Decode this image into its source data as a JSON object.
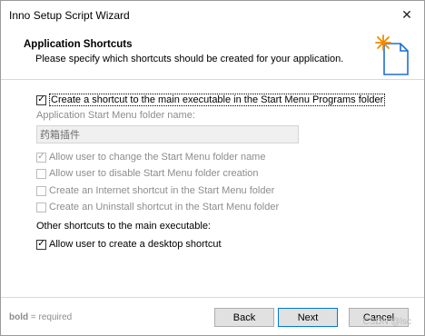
{
  "window": {
    "title": "Inno Setup Script Wizard"
  },
  "header": {
    "heading": "Application Shortcuts",
    "subheading": "Please specify which shortcuts should be created for your application."
  },
  "options": {
    "start_menu_shortcut": {
      "label": "Create a shortcut to the main executable in the Start Menu Programs folder",
      "checked": true,
      "enabled": true
    },
    "folder_name_label": "Application Start Menu folder name:",
    "folder_name_value": "药箱插件",
    "allow_change_folder": {
      "label": "Allow user to change the Start Menu folder name",
      "checked": true,
      "enabled": false
    },
    "allow_disable_folder": {
      "label": "Allow user to disable Start Menu folder creation",
      "checked": false,
      "enabled": false
    },
    "internet_shortcut": {
      "label": "Create an Internet shortcut in the Start Menu folder",
      "checked": false,
      "enabled": false
    },
    "uninstall_shortcut": {
      "label": "Create an Uninstall shortcut in the Start Menu folder",
      "checked": false,
      "enabled": false
    },
    "other_shortcuts_label": "Other shortcuts to the main executable:",
    "desktop_shortcut": {
      "label": "Allow user to create a desktop shortcut",
      "checked": true,
      "enabled": true
    }
  },
  "footer": {
    "note_bold": "bold",
    "note_rest": " = required",
    "back_label": "Back",
    "next_label": "Next",
    "cancel_label": "Cancel",
    "watermark": "CSDN @lsc"
  },
  "colors": {
    "accent_orange": "#f08a00",
    "icon_blue": "#1d6fd6",
    "focus_blue": "#0078d7"
  }
}
